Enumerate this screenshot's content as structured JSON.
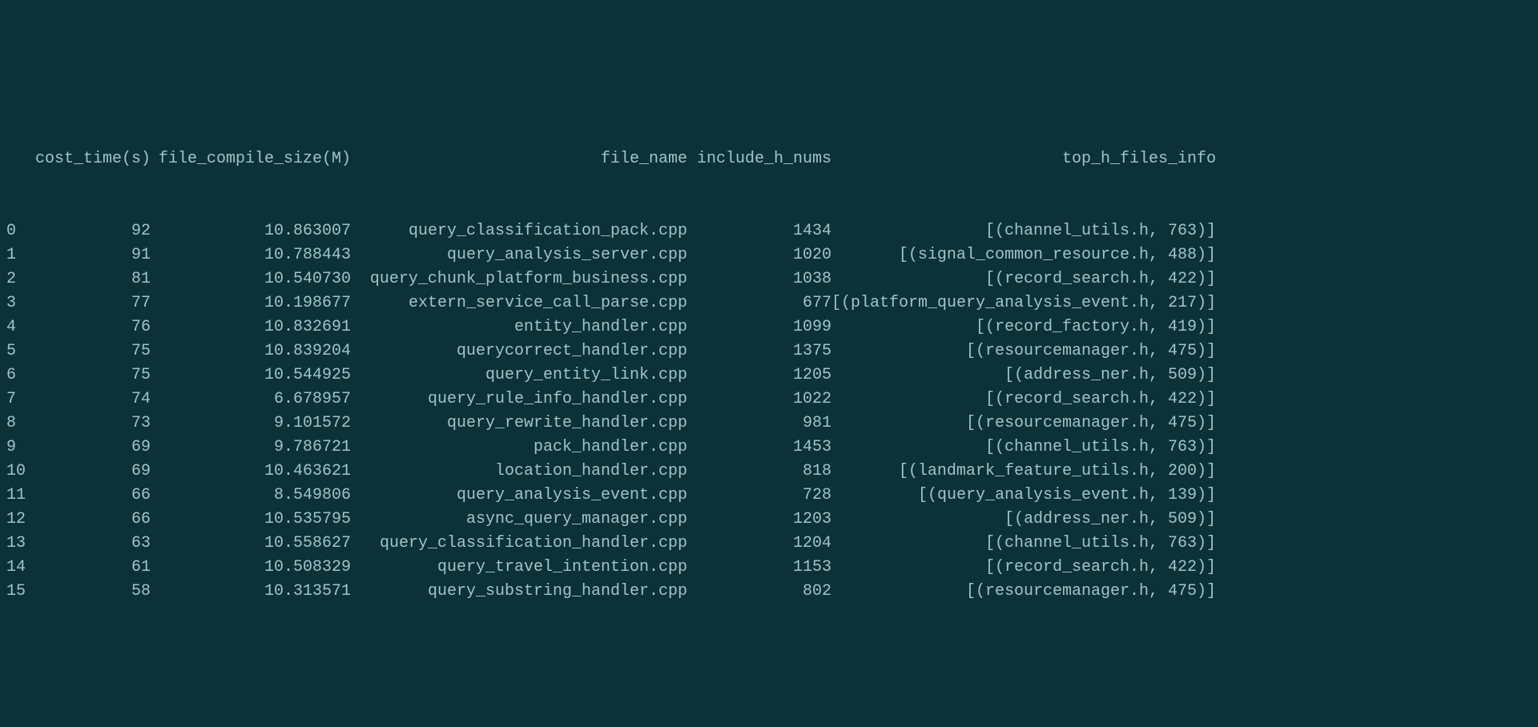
{
  "headers": {
    "index": "",
    "cost_time": "cost_time(s)",
    "file_compile_size": "file_compile_size(M)",
    "file_name": "file_name",
    "include_h_nums": "include_h_nums",
    "top_h_files_info": "top_h_files_info"
  },
  "rows": [
    {
      "index": "0",
      "cost_time": "92",
      "file_compile_size": "10.863007",
      "file_name": "query_classification_pack.cpp",
      "include_h_nums": "1434",
      "top_h_files_info": "[(channel_utils.h, 763)]"
    },
    {
      "index": "1",
      "cost_time": "91",
      "file_compile_size": "10.788443",
      "file_name": "query_analysis_server.cpp",
      "include_h_nums": "1020",
      "top_h_files_info": "[(signal_common_resource.h, 488)]"
    },
    {
      "index": "2",
      "cost_time": "81",
      "file_compile_size": "10.540730",
      "file_name": "query_chunk_platform_business.cpp",
      "include_h_nums": "1038",
      "top_h_files_info": "[(record_search.h, 422)]"
    },
    {
      "index": "3",
      "cost_time": "77",
      "file_compile_size": "10.198677",
      "file_name": "extern_service_call_parse.cpp",
      "include_h_nums": "677",
      "top_h_files_info": "[(platform_query_analysis_event.h, 217)]"
    },
    {
      "index": "4",
      "cost_time": "76",
      "file_compile_size": "10.832691",
      "file_name": "entity_handler.cpp",
      "include_h_nums": "1099",
      "top_h_files_info": "[(record_factory.h, 419)]"
    },
    {
      "index": "5",
      "cost_time": "75",
      "file_compile_size": "10.839204",
      "file_name": "querycorrect_handler.cpp",
      "include_h_nums": "1375",
      "top_h_files_info": "[(resourcemanager.h, 475)]"
    },
    {
      "index": "6",
      "cost_time": "75",
      "file_compile_size": "10.544925",
      "file_name": "query_entity_link.cpp",
      "include_h_nums": "1205",
      "top_h_files_info": "[(address_ner.h, 509)]"
    },
    {
      "index": "7",
      "cost_time": "74",
      "file_compile_size": "6.678957",
      "file_name": "query_rule_info_handler.cpp",
      "include_h_nums": "1022",
      "top_h_files_info": "[(record_search.h, 422)]"
    },
    {
      "index": "8",
      "cost_time": "73",
      "file_compile_size": "9.101572",
      "file_name": "query_rewrite_handler.cpp",
      "include_h_nums": "981",
      "top_h_files_info": "[(resourcemanager.h, 475)]"
    },
    {
      "index": "9",
      "cost_time": "69",
      "file_compile_size": "9.786721",
      "file_name": "pack_handler.cpp",
      "include_h_nums": "1453",
      "top_h_files_info": "[(channel_utils.h, 763)]"
    },
    {
      "index": "10",
      "cost_time": "69",
      "file_compile_size": "10.463621",
      "file_name": "location_handler.cpp",
      "include_h_nums": "818",
      "top_h_files_info": "[(landmark_feature_utils.h, 200)]"
    },
    {
      "index": "11",
      "cost_time": "66",
      "file_compile_size": "8.549806",
      "file_name": "query_analysis_event.cpp",
      "include_h_nums": "728",
      "top_h_files_info": "[(query_analysis_event.h, 139)]"
    },
    {
      "index": "12",
      "cost_time": "66",
      "file_compile_size": "10.535795",
      "file_name": "async_query_manager.cpp",
      "include_h_nums": "1203",
      "top_h_files_info": "[(address_ner.h, 509)]"
    },
    {
      "index": "13",
      "cost_time": "63",
      "file_compile_size": "10.558627",
      "file_name": "query_classification_handler.cpp",
      "include_h_nums": "1204",
      "top_h_files_info": "[(channel_utils.h, 763)]"
    },
    {
      "index": "14",
      "cost_time": "61",
      "file_compile_size": "10.508329",
      "file_name": "query_travel_intention.cpp",
      "include_h_nums": "1153",
      "top_h_files_info": "[(record_search.h, 422)]"
    },
    {
      "index": "15",
      "cost_time": "58",
      "file_compile_size": "10.313571",
      "file_name": "query_substring_handler.cpp",
      "include_h_nums": "802",
      "top_h_files_info": "[(resourcemanager.h, 475)]"
    }
  ]
}
